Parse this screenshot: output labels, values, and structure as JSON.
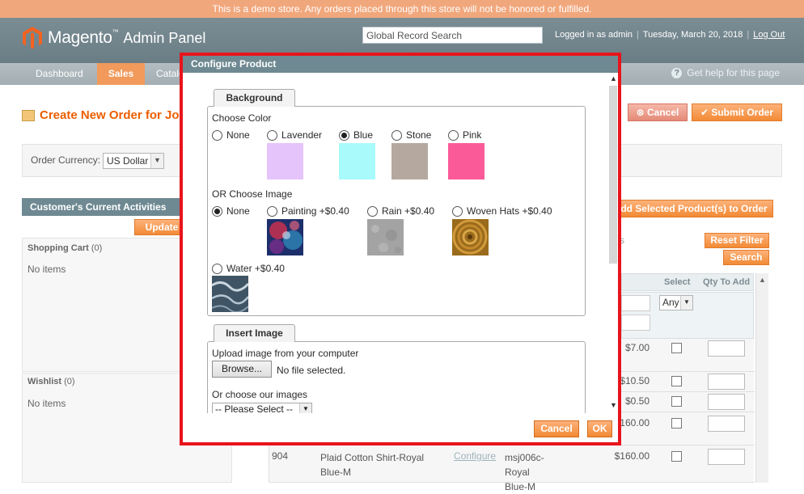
{
  "demo_notice": "This is a demo store. Any orders placed through this store will not be honored or fulfilled.",
  "header": {
    "brand": "Magento",
    "trademark": "™",
    "panel": "Admin Panel",
    "search_placeholder": "Global Record Search",
    "logged_in": "Logged in as admin",
    "date": "Tuesday, March 20, 2018",
    "logout": "Log Out"
  },
  "nav": {
    "items": [
      "Dashboard",
      "Sales",
      "Catalo"
    ],
    "help": "Get help for this page"
  },
  "page": {
    "title": "Create New Order for Jo",
    "cancel": "Cancel",
    "submit": "Submit Order",
    "currency_label": "Order Currency:",
    "currency_value": "US Dollar"
  },
  "sidebar": {
    "activities_title": "Customer's Current Activities",
    "update_button": "Update C",
    "shopping_cart": "Shopping Cart",
    "shopping_cart_count": "(0)",
    "wishlist": "Wishlist",
    "wishlist_count": "(0)",
    "no_items": "No items"
  },
  "grid": {
    "add_selected": "dd Selected Product(s) to Order",
    "reset_filter": "Reset Filter",
    "search": "Search",
    "stray_s": "s",
    "col_select": "Select",
    "col_qty": "Qty To Add",
    "any": "Any",
    "prices": [
      "$7.00",
      "$10.50",
      "$0.50",
      "$160.00",
      "$160.00"
    ],
    "last_row": {
      "id": "904",
      "name": "Plaid Cotton Shirt-Royal Blue-M",
      "configure": "Configure",
      "sku": "msj006c-Royal Blue-M"
    }
  },
  "dialog": {
    "title": "Configure Product",
    "background_tab": "Background",
    "choose_color": "Choose Color",
    "colors": [
      {
        "label": "None",
        "selected": false,
        "hex": ""
      },
      {
        "label": "Lavender",
        "selected": false,
        "hex": "#e5c3fb"
      },
      {
        "label": "Blue",
        "selected": true,
        "hex": "#a9fafb"
      },
      {
        "label": "Stone",
        "selected": false,
        "hex": "#b5a89e"
      },
      {
        "label": "Pink",
        "selected": false,
        "hex": "#fa5b98"
      }
    ],
    "or_choose_image": "OR Choose Image",
    "images": [
      {
        "label": "None",
        "selected": true
      },
      {
        "label": "Painting +$0.40",
        "selected": false
      },
      {
        "label": "Rain +$0.40",
        "selected": false
      },
      {
        "label": "Woven Hats +$0.40",
        "selected": false
      },
      {
        "label": "Water +$0.40",
        "selected": false
      }
    ],
    "insert_image_tab": "Insert Image",
    "upload_label": "Upload image from your computer",
    "browse": "Browse...",
    "no_file": "No file selected.",
    "choose_our_images": "Or choose our images",
    "please_select": "-- Please Select --",
    "cancel": "Cancel",
    "ok": "OK"
  }
}
